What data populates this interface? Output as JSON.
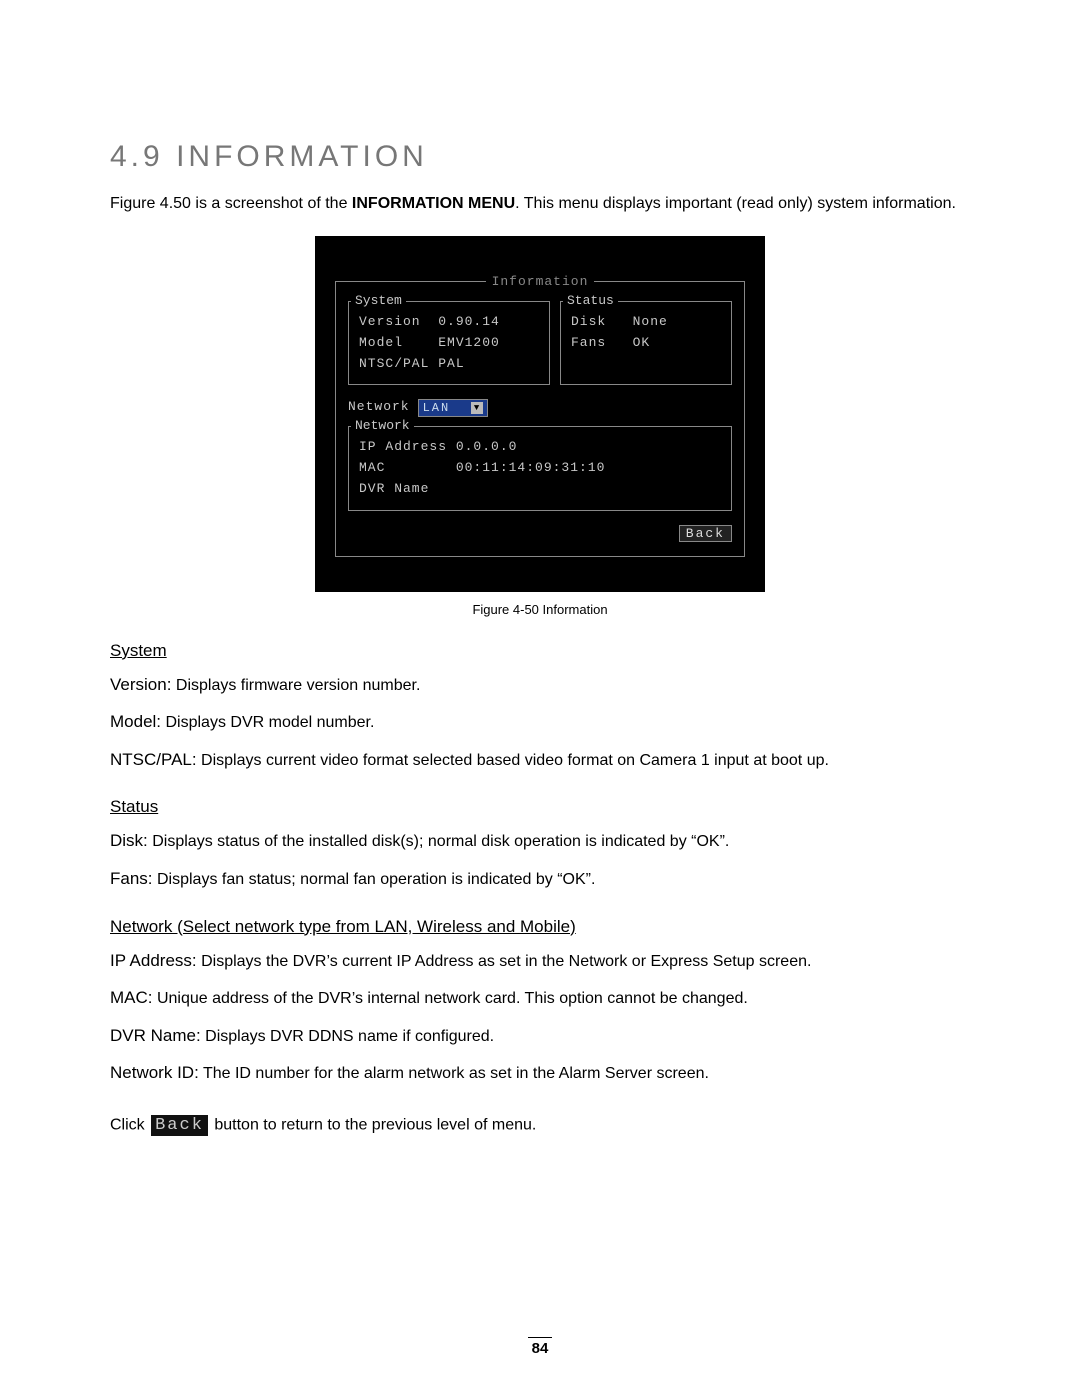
{
  "section_number": "4.9",
  "section_title": "INFORMATION",
  "intro_prefix": "Figure 4.50 is a screenshot of the ",
  "intro_bold": "INFORMATION MENU",
  "intro_suffix": ". This menu displays important (read only) system information.",
  "screenshot": {
    "title": "Information",
    "system": {
      "legend": "System",
      "lines": "Version  0.90.14\nModel    EMV1200\nNTSC/PAL PAL"
    },
    "status": {
      "legend": "Status",
      "lines": "Disk   None\nFans   OK"
    },
    "network_label": "Network",
    "network_dropdown": "LAN",
    "network": {
      "legend": "Network",
      "lines": "IP Address 0.0.0.0\nMAC        00:11:14:09:31:10\nDVR Name"
    },
    "back": "Back"
  },
  "caption": "Figure 4-50 Information",
  "sections": {
    "system": {
      "title": "System",
      "items": [
        {
          "term": "Version:",
          "desc": " Displays firmware version number."
        },
        {
          "term": "Model:",
          "desc": " Displays DVR model number."
        },
        {
          "term": "NTSC/PAL:",
          "desc": " Displays current video format selected based video format on Camera 1 input at boot up."
        }
      ]
    },
    "status": {
      "title": "Status",
      "items": [
        {
          "term": "Disk:",
          "desc": " Displays status of the installed disk(s); normal disk operation is indicated by “OK”."
        },
        {
          "term": "Fans:",
          "desc": " Displays fan status; normal fan operation is indicated by “OK”."
        }
      ]
    },
    "network": {
      "title": "Network (Select network type from LAN, Wireless and Mobile)",
      "items": [
        {
          "term": "IP Address:",
          "desc": " Displays the DVR’s current IP Address as set in the Network or Express Setup screen."
        },
        {
          "term": "MAC:",
          "desc": " Unique address of the DVR’s internal network card. This option cannot be changed."
        },
        {
          "term": "DVR Name:",
          "desc": " Displays DVR DDNS name if configured."
        },
        {
          "term": "Network ID:",
          "desc": " The ID number for the alarm network as set in the Alarm Server screen."
        }
      ]
    }
  },
  "click_prefix": "Click ",
  "click_button": "Back",
  "click_suffix": " button to return to the previous level of menu.",
  "page_number": "84"
}
